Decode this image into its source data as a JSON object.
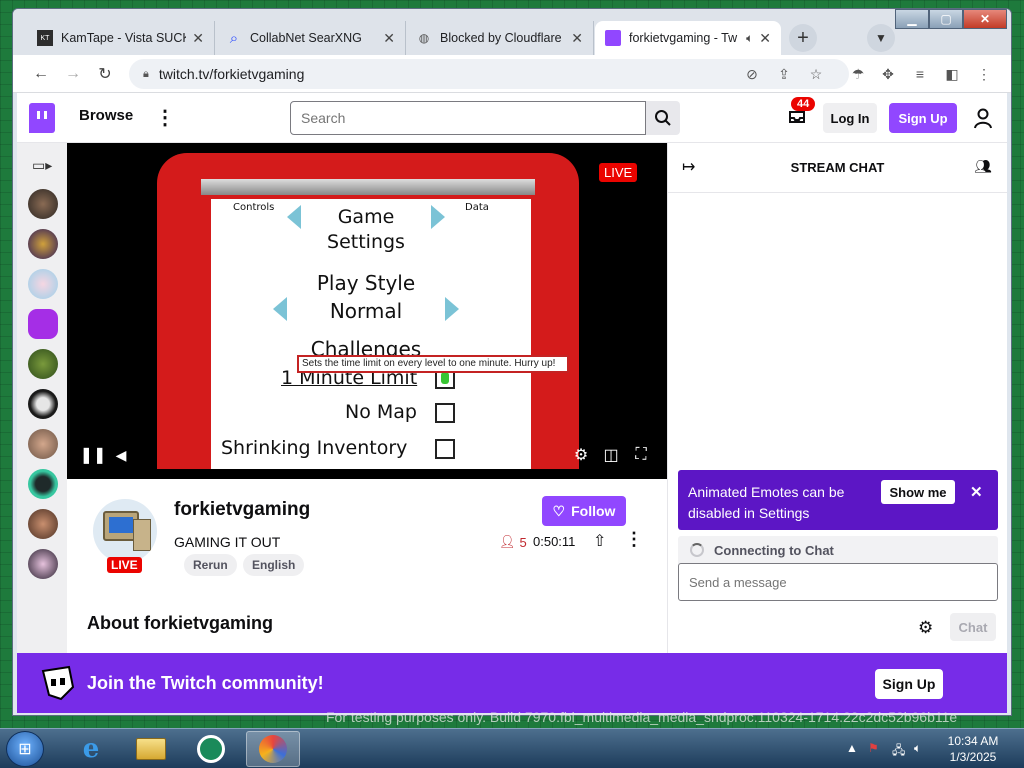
{
  "browser": {
    "tabs": [
      {
        "label": "KamTape - Vista SUCKS",
        "icon": "kamtape-favicon"
      },
      {
        "label": "CollabNet SearXNG",
        "icon": "search-favicon"
      },
      {
        "label": "Blocked by Cloudflare :(",
        "icon": "globe-favicon"
      },
      {
        "label": "forkietvgaming - Tw",
        "icon": "twitch-favicon"
      }
    ],
    "url": "twitch.tv/forkietvgaming"
  },
  "twitch": {
    "nav": {
      "browse": "Browse",
      "search_placeholder": "Search",
      "notifications_badge": "44",
      "login": "Log In",
      "signup": "Sign Up"
    },
    "player": {
      "live_badge": "LIVE",
      "game": {
        "controls": "Controls",
        "data": "Data",
        "game_settings": "Game\nSettings",
        "play_style": "Play Style",
        "normal": "Normal",
        "challenges": "Challenges",
        "one_minute": "1 Minute Limit",
        "no_map": "No Map",
        "shrinking": "Shrinking Inventory",
        "tooltip": "Sets the time limit on every level to one minute. Hurry up!"
      }
    },
    "channel": {
      "name": "forkietvgaming",
      "category": "GAMING IT OUT",
      "live": "LIVE",
      "tags": [
        "Rerun",
        "English"
      ],
      "follow": "Follow",
      "viewers": "5",
      "uptime": "0:50:11",
      "about": "About forkietvgaming"
    },
    "chat": {
      "title": "STREAM CHAT",
      "emote_banner": "Animated Emotes can be disabled in Settings",
      "show_me": "Show me",
      "connecting": "Connecting to Chat",
      "placeholder": "Send a message",
      "chat_button": "Chat"
    },
    "join_banner": {
      "text": "Join the Twitch community!",
      "signup": "Sign Up"
    }
  },
  "overlay": {
    "testing": "For testing purposes only. Build 7970.fbl_multimedia_media_sndproc.110324-1714.22c2dc52b96b11e"
  },
  "taskbar": {
    "time": "10:34 AM",
    "date": "1/3/2025"
  },
  "colors": {
    "twitch_purple": "#9147ff",
    "banner_purple": "#772ce8",
    "live_red": "#eb0400"
  }
}
